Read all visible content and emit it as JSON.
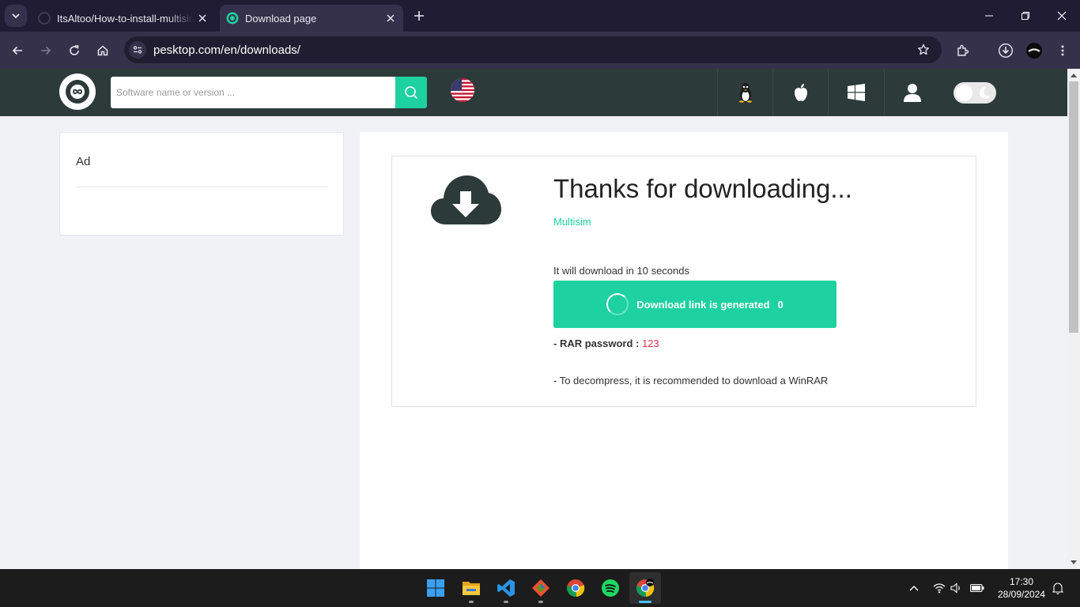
{
  "browser": {
    "tabs": [
      {
        "title": "ItsAltoo/How-to-install-multisim",
        "active": false
      },
      {
        "title": "Download page",
        "active": true
      }
    ],
    "url": "pesktop.com/en/downloads/"
  },
  "site": {
    "search_placeholder": "Software name or version ...",
    "accent_color": "#1dd1a1",
    "header_color": "#2d3a3a",
    "nav_icons": [
      "linux-icon",
      "apple-icon",
      "windows-icon",
      "user-icon"
    ]
  },
  "sidebar": {
    "ad_label": "Ad"
  },
  "download": {
    "heading": "Thanks for downloading...",
    "product": "Multisim",
    "countdown_text": "It will download in 10 seconds",
    "button_label": "Download link is generated",
    "button_count": "0",
    "rar_prefix": "- RAR password : ",
    "rar_password": "123",
    "winrar_note": "- To decompress, it is recommended to download a WinRAR"
  },
  "taskbar": {
    "apps": [
      "windows-start",
      "file-explorer",
      "vs-code",
      "git",
      "chrome",
      "spotify",
      "chrome-profile"
    ],
    "time": "17:30",
    "date": "28/09/2024"
  }
}
